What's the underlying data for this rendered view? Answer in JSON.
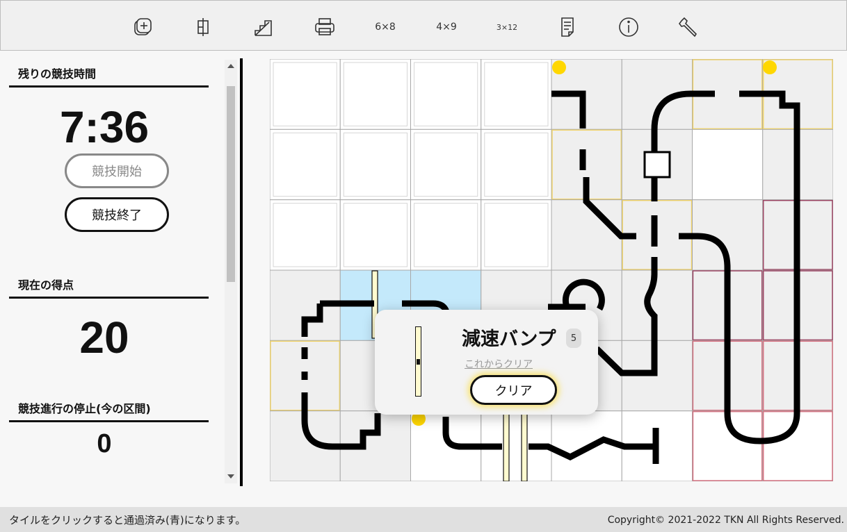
{
  "toolbar": {
    "buttons": [
      {
        "name": "add-icon"
      },
      {
        "name": "split-icon"
      },
      {
        "name": "stairs-icon"
      },
      {
        "name": "print-icon"
      },
      {
        "name": "layout-6x8",
        "label": "6×8"
      },
      {
        "name": "layout-4x9",
        "label": "4×9"
      },
      {
        "name": "layout-3x12",
        "label": "3×12"
      },
      {
        "name": "document-icon"
      },
      {
        "name": "info-icon"
      },
      {
        "name": "wrench-icon"
      }
    ]
  },
  "side": {
    "time_header": "残りの競技時間",
    "time_value": "7:36",
    "start_button": "競技開始",
    "end_button": "競技終了",
    "score_header": "現在の得点",
    "score_value": "20",
    "stop_header": "競技進行の停止(今の区間)",
    "stop_value": "0"
  },
  "popup": {
    "title": "減速バンプ",
    "badge": "5",
    "link": "これからクリア",
    "button": "クリア"
  },
  "footer": {
    "hint": "タイルをクリックすると通過済み(青)になります。",
    "copyright": "Copyright© 2021-2022 TKN All Rights Reserved."
  },
  "colors": {
    "passed_tile": "#c4e9fb",
    "grey_tile": "#efefef",
    "track": "#000000",
    "checkpoint": "#ffd700",
    "highlight_yellow": "#f2d56b",
    "highlight_red": "#d87080",
    "highlight_purple": "#9c4060"
  },
  "board": {
    "cols": 8,
    "rows": 6,
    "tile_fill": [
      [
        "w",
        "w",
        "w",
        "w",
        "g",
        "g",
        "g",
        "g"
      ],
      [
        "w",
        "w",
        "w",
        "w",
        "g",
        "g",
        "w",
        "g"
      ],
      [
        "w",
        "w",
        "w",
        "w",
        "g",
        "g",
        "g",
        "g"
      ],
      [
        "g",
        "b",
        "b",
        "g",
        "g",
        "g",
        "g",
        "g"
      ],
      [
        "g",
        "g",
        "g",
        "g",
        "g",
        "g",
        "g",
        "g"
      ],
      [
        "g",
        "g",
        "w",
        "w",
        "w",
        "w",
        "w",
        "w"
      ]
    ],
    "tile_outline": [
      [
        "n",
        "n",
        "n",
        "n",
        "n",
        "n",
        "y",
        "y"
      ],
      [
        "n",
        "n",
        "n",
        "n",
        "y",
        "n",
        "n",
        "n"
      ],
      [
        "n",
        "n",
        "n",
        "n",
        "n",
        "y",
        "n",
        "p"
      ],
      [
        "n",
        "n",
        "n",
        "n",
        "n",
        "n",
        "p",
        "p"
      ],
      [
        "y",
        "n",
        "n",
        "n",
        "n",
        "n",
        "r",
        "r"
      ],
      [
        "n",
        "n",
        "n",
        "n",
        "n",
        "n",
        "r",
        "r"
      ]
    ]
  }
}
